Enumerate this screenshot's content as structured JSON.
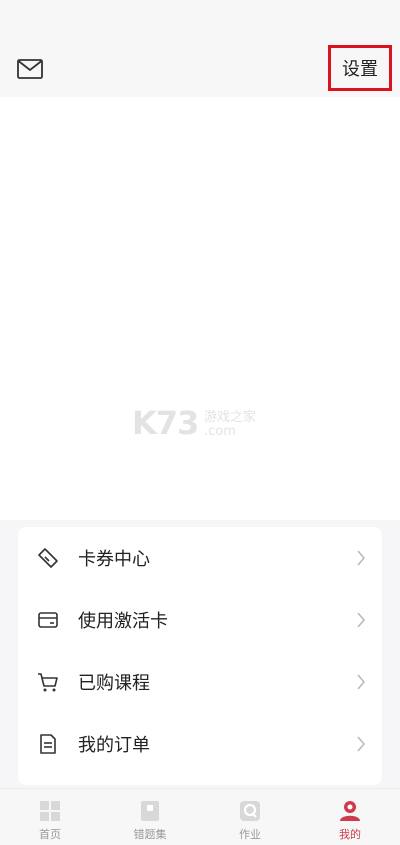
{
  "header": {
    "mail_icon": "mail-icon",
    "settings_label": "设置",
    "highlight_color": "#d9141e"
  },
  "watermark": {
    "brand": "K73",
    "cn": "游戏之家",
    "domain": ".com"
  },
  "menu": {
    "items": [
      {
        "label": "卡券中心",
        "icon": "coupon-icon"
      },
      {
        "label": "使用激活卡",
        "icon": "card-icon"
      },
      {
        "label": "已购课程",
        "icon": "cart-icon"
      },
      {
        "label": "我的订单",
        "icon": "document-icon"
      }
    ]
  },
  "tabbar": {
    "active_color": "#d03a4f",
    "tabs": [
      {
        "label": "首页",
        "icon": "home-icon"
      },
      {
        "label": "错题集",
        "icon": "mistakes-icon"
      },
      {
        "label": "作业",
        "icon": "homework-icon"
      },
      {
        "label": "我的",
        "icon": "profile-icon",
        "active": true
      }
    ]
  }
}
